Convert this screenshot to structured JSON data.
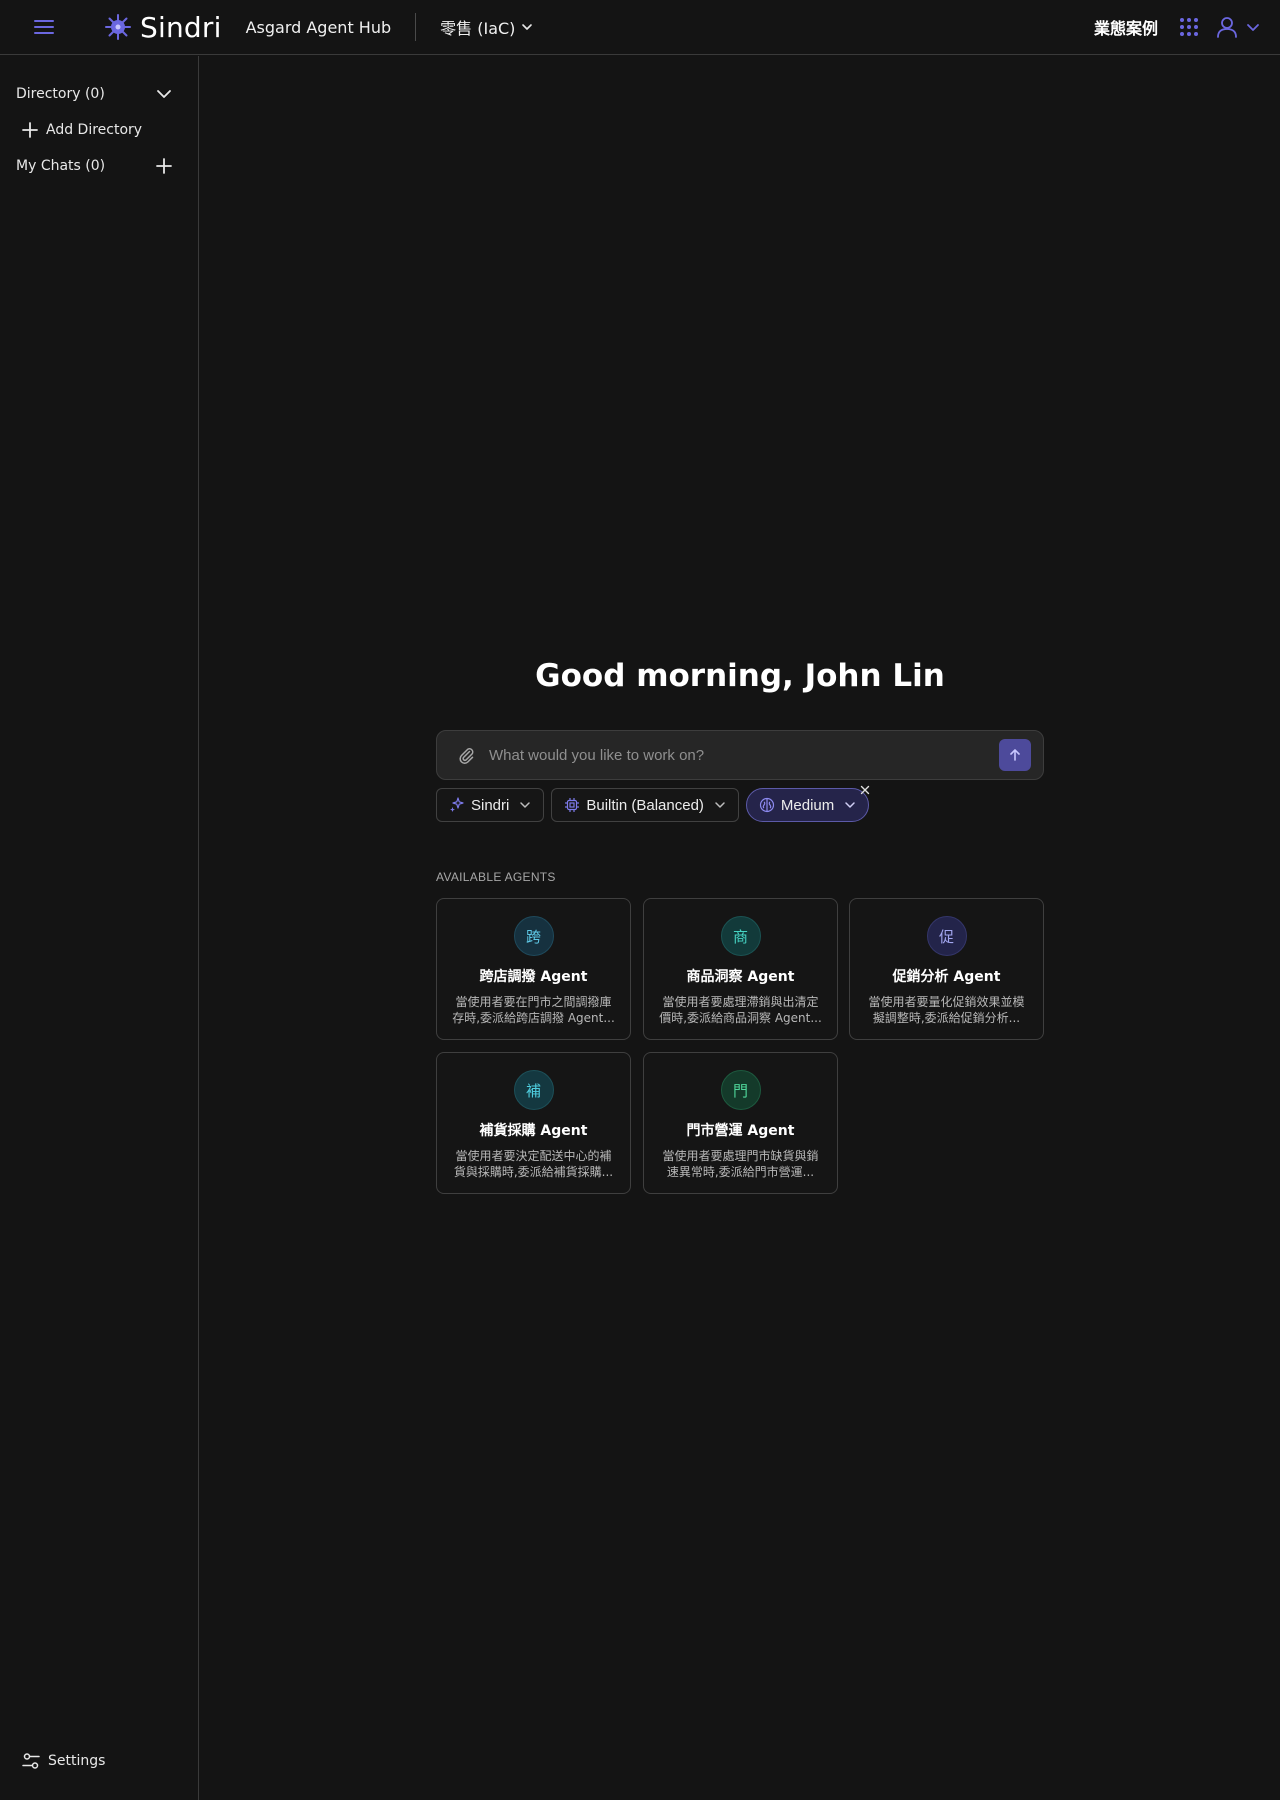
{
  "header": {
    "app_name": "Sindri",
    "hub_title": "Asgard Agent Hub",
    "workspace": "零售 (IaC)",
    "cases_link": "業態案例",
    "accent_color": "#6b67e0"
  },
  "sidebar": {
    "directory_label": "Directory (0)",
    "add_directory_label": "Add Directory",
    "my_chats_label": "My Chats (0)",
    "settings_label": "Settings"
  },
  "main": {
    "greeting": "Good morning, John Lin",
    "chat_placeholder": "What would you like to work on?",
    "chips": {
      "agent": "Sindri",
      "model": "Builtin (Balanced)",
      "effort": "Medium"
    },
    "agents_heading": "AVAILABLE AGENTS",
    "agents": [
      {
        "glyph": "跨",
        "name": "跨店調撥 Agent",
        "desc": "當使用者要在門市之間調撥庫存時,委派給跨店調撥 Agent...",
        "bg": "#16313f",
        "fg": "#5ec8e6",
        "border": "#1f4a5c"
      },
      {
        "glyph": "商",
        "name": "商品洞察 Agent",
        "desc": "當使用者要處理滯銷與出清定價時,委派給商品洞察 Agent...",
        "bg": "#123a3a",
        "fg": "#46d4c4",
        "border": "#1b5353"
      },
      {
        "glyph": "促",
        "name": "促銷分析 Agent",
        "desc": "當使用者要量化促銷效果並模擬調整時,委派給促銷分析...",
        "bg": "#23244a",
        "fg": "#a3a7f0",
        "border": "#34366a"
      },
      {
        "glyph": "補",
        "name": "補貨採購 Agent",
        "desc": "當使用者要決定配送中心的補貨與採購時,委派給補貨採購...",
        "bg": "#143840",
        "fg": "#4fcfe0",
        "border": "#1d5059"
      },
      {
        "glyph": "門",
        "name": "門市營運 Agent",
        "desc": "當使用者要處理門市缺貨與銷速異常時,委派給門市營運...",
        "bg": "#143a2a",
        "fg": "#4fd69a",
        "border": "#1d5a3f"
      }
    ]
  }
}
